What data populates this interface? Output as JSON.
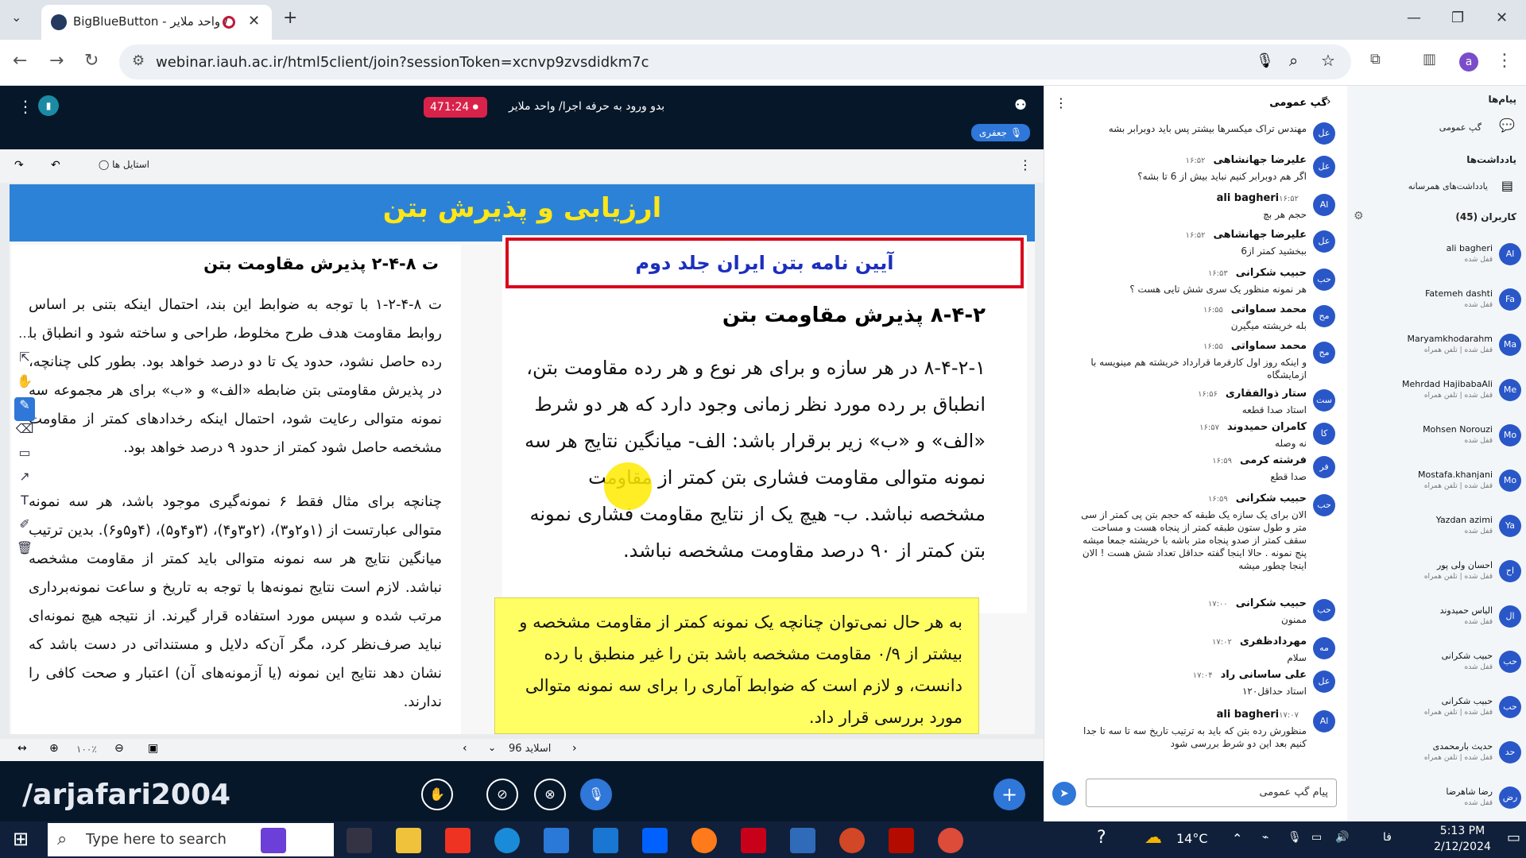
{
  "browser": {
    "tab_title": "BigBlueButton - واحد ملایر /",
    "url": "webinar.iauh.ac.ir/html5client/join?sessionToken=xcnvp9zvsdidkm7c",
    "profile_letter": "a"
  },
  "meeting": {
    "timer": "471:24",
    "title": "بدو ورود به حرفه اجرا/ واحد ملایر",
    "speaker": "جعفری",
    "styles_label": "استایل ها",
    "slide_label": "اسلاید 96",
    "zoom": "۱۰۰٪",
    "watermark": "/arjafari2004"
  },
  "slide": {
    "banner": "ارزیابی و پذیرش بتن",
    "left_heading": "ت ۸-۴-۲   پذیرش مقاومت بتن",
    "left_p1": "ت ۸-۴-۲-۱ با توجه به ضوابط این بند، احتمال اینکه بتنی بر اساس روابط مقاومت هدف طرح مخلوط، طراحی و ساخته شود و انطباق با رده حاصل نشود، حدود یک تا دو درصد خواهد بود. بطور کلی چنانچه، در پذیرش مقاومتی بتن ضابطه «الف» و «ب» برای هر مجموعه سه نمونه متوالی رعایت شود، احتمال اینکه رخدادهای کمتر از مقاومت مشخصه حاصل شود کمتر از حدود ۹ درصد خواهد بود.",
    "left_p2": "چنانچه برای مثال فقط ۶ نمونه‌گیری موجود باشد، هر سه نمونه متوالی عبارتست از (۱و۲و۳)، (۲و۳و۴)، (۳و۴و۵)، (۴و۵و۶). بدین ترتیب میانگین نتایج هر سه نمونه متوالی باید کمتر از مقاومت مشخصه نباشد. لازم است نتایج نمونه‌ها با توجه به تاریخ و ساعت نمونه‌برداری مرتب شده و سپس مورد استفاده قرار گیرند. از نتیجه هیچ نمونه‌ای نباید صرف‌نظر کرد، مگر آن‌که دلایل و مستنداتی در دست باشد که نشان دهد نتایج این نمونه (یا آزمونه‌های آن) اعتبار و صحت کافی را ندارند.",
    "red_box": "آیین نامه بتن ایران جلد دوم",
    "right_heading": "۸-۴-۲   پذیرش مقاومت بتن",
    "right_body": "۸-۴-۲-۱ در هر سازه و برای هر نوع و هر رده مقاومت بتن، انطباق بر رده مورد نظر زمانی وجود دارد که هر دو شرط «الف» و «ب» زیر برقرار باشد: الف- میانگین نتایج هر سه نمونه متوالی مقاومت فشاری بتن کمتر از مقاومت مشخصه نباشد. ب- هیچ یک از نتایج مقاومت فشاری نمونه بتن کمتر از ۹۰ درصد مقاومت مشخصه نباشد.",
    "yellow_box": "به هر حال نمی‌توان چنانچه یک نمونه کمتر از مقاومت مشخصه و بیشتر از ۰/۹ مقاومت مشخصه باشد بتن را غیر منطبق با رده دانست، و لازم است که ضوابط آماری را برای سه نمونه متوالی مورد بررسی قرار داد."
  },
  "chat": {
    "title": "گپ عمومی",
    "input_placeholder": "پیام گپ عمومی",
    "messages": [
      {
        "av": "عل",
        "name": "",
        "time": "",
        "text": "مهندس تراک میکسرها بیشتر پس باید دوبرابر بشه"
      },
      {
        "av": "عل",
        "name": "علیرضا جهانشاهی",
        "time": "۱۶:۵۲",
        "text": "اگر هم دوبرابر کنیم نباید بیش از 6 تا بشه؟"
      },
      {
        "av": "Al",
        "name": "ali bagheri",
        "time": "۱۶:۵۲",
        "text": "حجم هر بچ"
      },
      {
        "av": "عل",
        "name": "علیرضا جهانشاهی",
        "time": "۱۶:۵۲",
        "text": "ببخشید کمتر از6"
      },
      {
        "av": "حب",
        "name": "حبیب شکرانی",
        "time": "۱۶:۵۳",
        "text": "هر نمونه منظور یک سری شش تایی هست ؟"
      },
      {
        "av": "مح",
        "name": "محمد سماواتی",
        "time": "۱۶:۵۵",
        "text": "بله خریشته میگیرن"
      },
      {
        "av": "مح",
        "name": "محمد سماواتی",
        "time": "۱۶:۵۵",
        "text": "و اینکه روز اول کارفرما قرارداد خریشته هم مینویسه با ازمایشگاه"
      },
      {
        "av": "ست",
        "name": "ستار ذوالفقاری",
        "time": "۱۶:۵۶",
        "text": "استاد صدا قطعه"
      },
      {
        "av": "کا",
        "name": "کامران حمیدوند",
        "time": "۱۶:۵۷",
        "text": "نه وصله"
      },
      {
        "av": "فر",
        "name": "فرشته کرمی",
        "time": "۱۶:۵۹",
        "text": "صدا قطع"
      },
      {
        "av": "حب",
        "name": "حبیب شکرانی",
        "time": "۱۶:۵۹",
        "text": "الان برای یک سازه یک طبقه که حجم بتن پی کمتر از سی متر و طول ستون طبقه کمتر از پنجاه هست و مساحت سقف کمتر از صدو پنجاه متر باشه با خریشته جمعا میشه پنج نمونه . حالا اینجا گفته حداقل تعداد شش هست ! الان اینجا چطور میشه"
      },
      {
        "av": "حب",
        "name": "حبیب شکرانی",
        "time": "۱۷:۰۰",
        "text": "ممنون"
      },
      {
        "av": "مه",
        "name": "مهردادظفری",
        "time": "۱۷:۰۲",
        "text": "سلام"
      },
      {
        "av": "عل",
        "name": "علی ساسانی راد",
        "time": "۱۷:۰۴",
        "text": "استاد حداقل۱۲۰"
      },
      {
        "av": "Al",
        "name": "ali bagheri",
        "time": "۱۷:۰۷",
        "text": "منظورش رده بتن که باید به ترتیب تاریخ سه تا سه تا جدا کنیم بعد این دو شرط بررسی شود"
      }
    ]
  },
  "users_panel": {
    "messages_label": "پیام‌ها",
    "public_chat": "گپ عمومی",
    "notes_label": "یادداشت‌ها",
    "shared_notes": "یادداشت‌های همرسانه",
    "users_label": "کاربران (45)",
    "users": [
      {
        "av": "Al",
        "name": "ali bagheri",
        "status": "قفل شده"
      },
      {
        "av": "Fa",
        "name": "Fatemeh dashti",
        "status": "قفل شده"
      },
      {
        "av": "Ma",
        "name": "Maryamkhodarahm",
        "status": "قفل شده | تلفن همراه"
      },
      {
        "av": "Me",
        "name": "Mehrdad HajibabaAli",
        "status": "قفل شده | تلفن همراه"
      },
      {
        "av": "Mo",
        "name": "Mohsen Norouzi",
        "status": "قفل شده"
      },
      {
        "av": "Mo",
        "name": "Mostafa.khanjani",
        "status": "قفل شده | تلفن همراه"
      },
      {
        "av": "Ya",
        "name": "Yazdan azimi",
        "status": "قفل شده"
      },
      {
        "av": "اح",
        "name": "احسان ولی پور",
        "status": "قفل شده | تلفن همراه"
      },
      {
        "av": "ال",
        "name": "الیاس حمیدوند",
        "status": "قفل شده"
      },
      {
        "av": "حب",
        "name": "حبیب شکرانی",
        "status": "قفل شده"
      },
      {
        "av": "حب",
        "name": "حبیب شکرانی",
        "status": "قفل شده | تلفن همراه"
      },
      {
        "av": "حد",
        "name": "حدیث بارمحمدی",
        "status": "قفل شده | تلفن همراه"
      },
      {
        "av": "رض",
        "name": "رضا شاهرضا",
        "status": "قفل شده"
      }
    ]
  },
  "taskbar": {
    "search_placeholder": "Type here to search",
    "temperature": "14°C",
    "lang": "فا",
    "time": "5:13 PM",
    "date": "2/12/2024"
  }
}
